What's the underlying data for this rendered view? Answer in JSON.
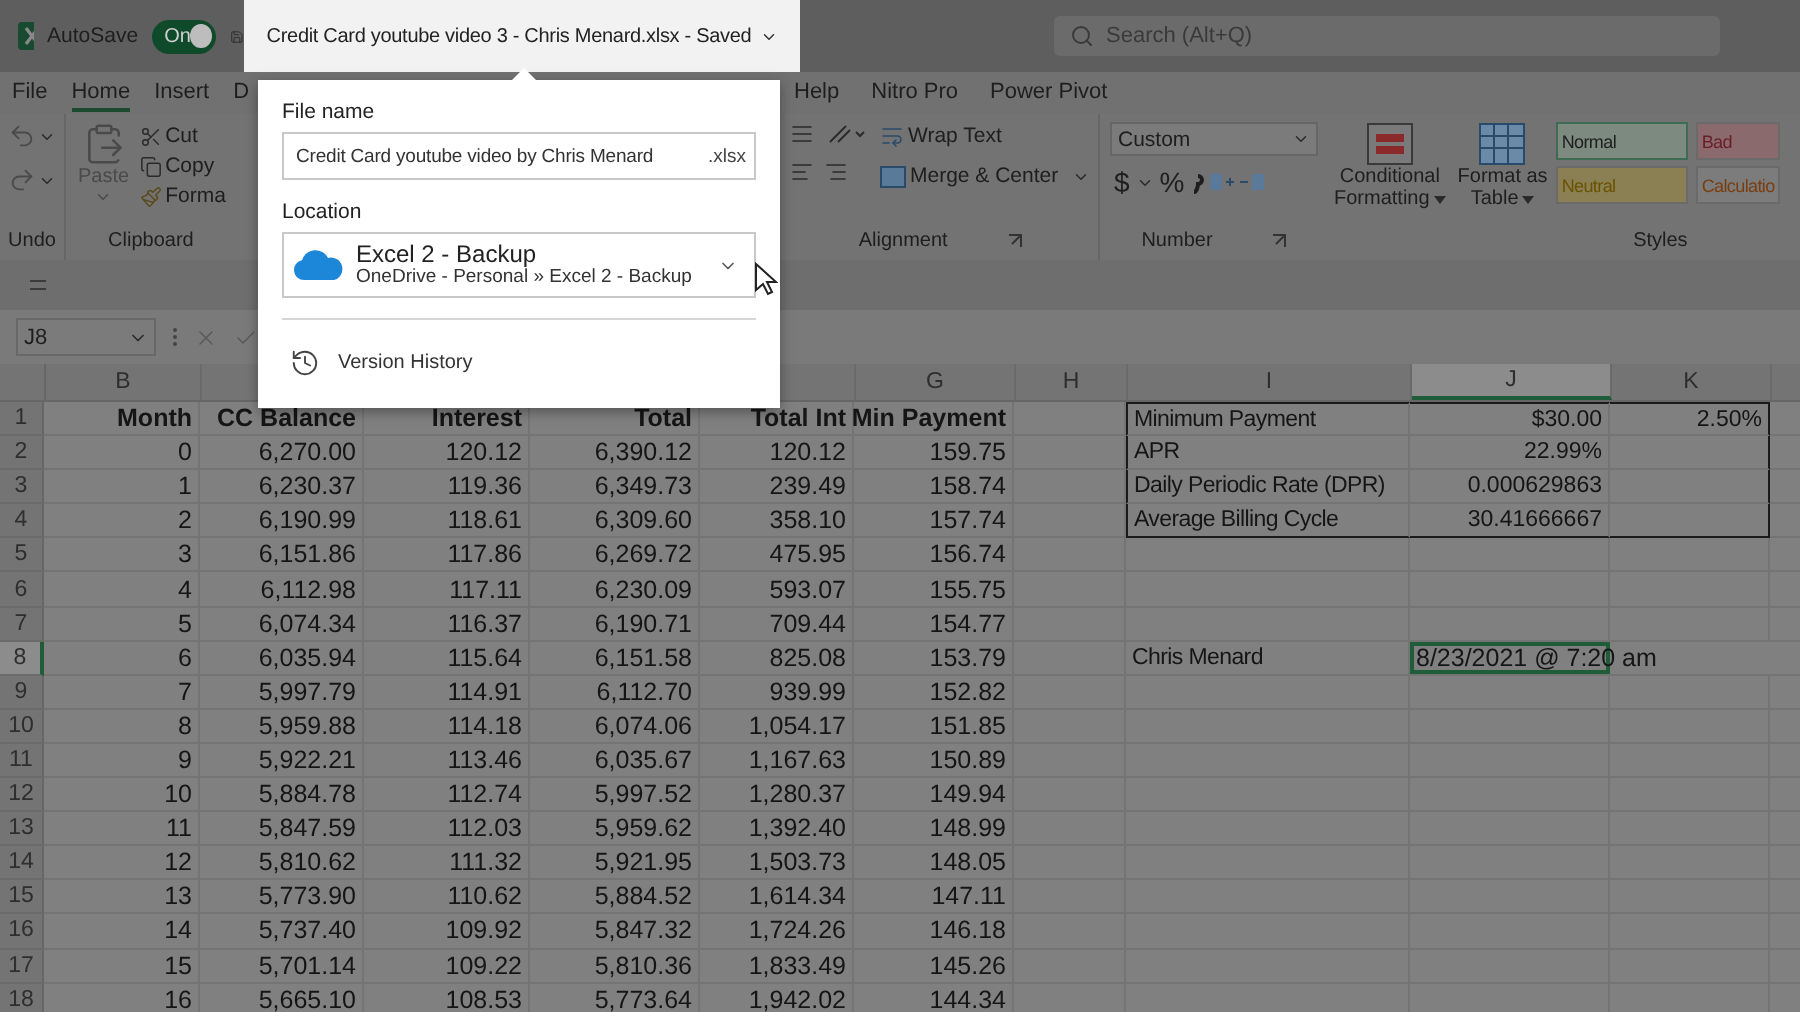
{
  "title_bar": {
    "autosave_label": "AutoSave",
    "autosave": {
      "on": true,
      "label": "On"
    },
    "document_title": "Credit Card youtube video 3 - Chris Menard.xlsx  -  Saved",
    "search": {
      "placeholder": "Search (Alt+Q)"
    }
  },
  "tabs": {
    "left": [
      {
        "label": "File",
        "selected": false
      },
      {
        "label": "Home",
        "selected": true
      },
      {
        "label": "Insert",
        "selected": false
      },
      {
        "label": "D",
        "selected": false
      }
    ],
    "right": [
      {
        "label": "Help",
        "selected": false
      },
      {
        "label": "Nitro Pro",
        "selected": false
      },
      {
        "label": "Power Pivot",
        "selected": false
      }
    ]
  },
  "ribbon": {
    "undo": {
      "label": "Undo"
    },
    "clipboard": {
      "label": "Clipboard",
      "paste": "Paste",
      "cut": "Cut",
      "copy": "Copy",
      "format": "Forma"
    },
    "alignment": {
      "label": "Alignment",
      "wrap_text": "Wrap Text",
      "merge": "Merge & Center"
    },
    "number": {
      "label": "Number",
      "format": "Custom",
      "currency": "$",
      "percent": "%"
    },
    "styles": {
      "label": "Styles",
      "conditional": [
        "Conditional",
        "Formatting"
      ],
      "format_table": [
        "Format as",
        "Table"
      ],
      "cells": [
        {
          "label": "Normal",
          "color": "#7d8a80"
        },
        {
          "label": "Bad",
          "color": "#8a6a6d"
        },
        {
          "label": "Neutral",
          "color": "#8a8054"
        },
        {
          "label": "Calculatio",
          "color": "#7c7c7c"
        }
      ]
    }
  },
  "formula_bar": {
    "name_box": "J8"
  },
  "file_popup": {
    "file_name_label": "File name",
    "file_name": "Credit Card youtube video by Chris Menard",
    "extension": ".xlsx",
    "location_label": "Location",
    "location": {
      "name": "Excel 2 - Backup",
      "path": "OneDrive - Personal » Excel 2 - Backup"
    },
    "version_history": "Version History"
  },
  "sheet": {
    "columns": [
      {
        "label": "B",
        "selected": false
      },
      {},
      {},
      {},
      {},
      {
        "label": "G",
        "selected": false
      },
      {
        "label": "H",
        "selected": false
      },
      {
        "label": "I",
        "selected": false
      },
      {
        "label": "J",
        "selected": true
      },
      {
        "label": "K",
        "selected": false
      }
    ],
    "rows": [
      {
        "number": "1",
        "selected": false,
        "kind": "header",
        "cells": [
          "Month",
          "CC Balance",
          "Interest",
          "Total",
          "Total Int",
          "Min Payment"
        ],
        "side": {
          "kind": "summary",
          "cells": [
            "Minimum Payment",
            "$30.00",
            "2.50%"
          ]
        }
      },
      {
        "number": "2",
        "selected": false,
        "kind": "data",
        "cells": [
          "0",
          "6,270.00",
          "120.12",
          "6,390.12",
          "120.12",
          "159.75"
        ],
        "side": {
          "kind": "summary",
          "cells": [
            "APR",
            "22.99%"
          ]
        }
      },
      {
        "number": "3",
        "selected": false,
        "kind": "data",
        "cells": [
          "1",
          "6,230.37",
          "119.36",
          "6,349.73",
          "239.49",
          "158.74"
        ],
        "side": {
          "kind": "summary",
          "cells": [
            "Daily Periodic Rate (DPR)",
            "0.000629863"
          ]
        }
      },
      {
        "number": "4",
        "selected": false,
        "kind": "data",
        "cells": [
          "2",
          "6,190.99",
          "118.61",
          "6,309.60",
          "358.10",
          "157.74"
        ],
        "side": {
          "kind": "summary",
          "cells": [
            "Average Billing Cycle",
            "30.41666667"
          ]
        }
      },
      {
        "number": "5",
        "selected": false,
        "kind": "data",
        "cells": [
          "3",
          "6,151.86",
          "117.86",
          "6,269.72",
          "475.95",
          "156.74"
        ]
      },
      {
        "number": "6",
        "selected": false,
        "kind": "data",
        "cells": [
          "4",
          "6,112.98",
          "117.11",
          "6,230.09",
          "593.07",
          "155.75"
        ]
      },
      {
        "number": "7",
        "selected": false,
        "kind": "data",
        "cells": [
          "5",
          "6,074.34",
          "116.37",
          "6,190.71",
          "709.44",
          "154.77"
        ]
      },
      {
        "number": "8",
        "selected": true,
        "kind": "data",
        "cells": [
          "6",
          "6,035.94",
          "115.64",
          "6,151.58",
          "825.08",
          "153.79"
        ],
        "side": {
          "kind": "note",
          "cells": [
            "Chris Menard",
            "8/23/2021 @ 7:20 am"
          ]
        }
      },
      {
        "number": "9",
        "selected": false,
        "kind": "data",
        "cells": [
          "7",
          "5,997.79",
          "114.91",
          "6,112.70",
          "939.99",
          "152.82"
        ]
      },
      {
        "number": "10",
        "selected": false,
        "kind": "data",
        "cells": [
          "8",
          "5,959.88",
          "114.18",
          "6,074.06",
          "1,054.17",
          "151.85"
        ]
      },
      {
        "number": "11",
        "selected": false,
        "kind": "data",
        "cells": [
          "9",
          "5,922.21",
          "113.46",
          "6,035.67",
          "1,167.63",
          "150.89"
        ]
      },
      {
        "number": "12",
        "selected": false,
        "kind": "data",
        "cells": [
          "10",
          "5,884.78",
          "112.74",
          "5,997.52",
          "1,280.37",
          "149.94"
        ]
      },
      {
        "number": "13",
        "selected": false,
        "kind": "data",
        "cells": [
          "11",
          "5,847.59",
          "112.03",
          "5,959.62",
          "1,392.40",
          "148.99"
        ]
      },
      {
        "number": "14",
        "selected": false,
        "kind": "data",
        "cells": [
          "12",
          "5,810.62",
          "111.32",
          "5,921.95",
          "1,503.73",
          "148.05"
        ]
      },
      {
        "number": "15",
        "selected": false,
        "kind": "data",
        "cells": [
          "13",
          "5,773.90",
          "110.62",
          "5,884.52",
          "1,614.34",
          "147.11"
        ]
      },
      {
        "number": "16",
        "selected": false,
        "kind": "data",
        "cells": [
          "14",
          "5,737.40",
          "109.92",
          "5,847.32",
          "1,724.26",
          "146.18"
        ]
      },
      {
        "number": "17",
        "selected": false,
        "kind": "data",
        "cells": [
          "15",
          "5,701.14",
          "109.22",
          "5,810.36",
          "1,833.49",
          "145.26"
        ]
      },
      {
        "number": "18",
        "selected": false,
        "kind": "data",
        "cells": [
          "16",
          "5,665.10",
          "108.53",
          "5,773.64",
          "1,942.02",
          "144.34"
        ]
      }
    ]
  }
}
